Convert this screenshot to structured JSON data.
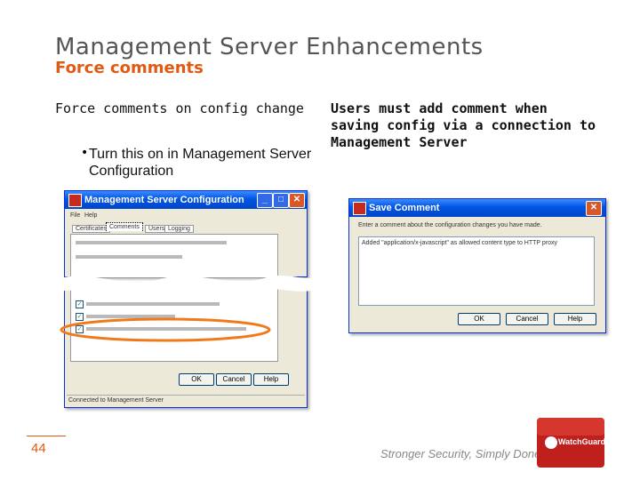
{
  "slide": {
    "title": "Management Server Enhancements",
    "subtitle": "Force comments",
    "left_heading": "Force comments on config change",
    "left_bullet": "Turn this on in Management Server Configuration",
    "right_heading": "Users must add comment when saving config via a connection to Management Server",
    "page_number": "44",
    "tagline": "Stronger Security, Simply Done™",
    "logo_text": "WatchGuard"
  },
  "config_window": {
    "title": "Management Server Configuration",
    "menu": [
      "File",
      "Help"
    ],
    "tabs": [
      "Certificates",
      "Comments",
      "Users",
      "Logging"
    ],
    "ok_label": "OK",
    "cancel_label": "Cancel",
    "help_label": "Help",
    "status_text": "Connected to Management Server"
  },
  "comment_dialog": {
    "title": "Save Comment",
    "prompt": "Enter a comment about the configuration changes you have made.",
    "comment_value": "Added \"application/x-javascript\" as allowed content type to HTTP proxy",
    "ok_label": "OK",
    "cancel_label": "Cancel",
    "help_label": "Help"
  },
  "colors": {
    "accent": "#e05a12",
    "title_gray": "#555555",
    "highlight_ellipse": "#f07a1a",
    "logo_red": "#c0201c"
  }
}
